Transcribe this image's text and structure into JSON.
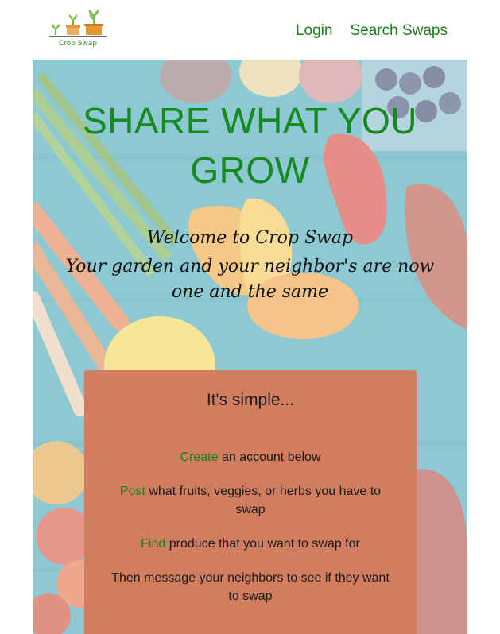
{
  "header": {
    "logo_text": "Crop Swap",
    "nav": [
      {
        "label": "Login"
      },
      {
        "label": "Search Swaps"
      }
    ]
  },
  "hero": {
    "headline": "SHARE WHAT YOU GROW",
    "welcome": "Welcome to Crop Swap",
    "tagline": "Your garden and your neighbor's are now one and the same"
  },
  "steps_card": {
    "title": "It's simple...",
    "steps": [
      {
        "keyword": "Create",
        "text": " an account below"
      },
      {
        "keyword": "Post",
        "text": " what fruits, veggies, or herbs you have to swap"
      },
      {
        "keyword": "Find",
        "text": " produce that you want to swap for"
      },
      {
        "keyword": "",
        "text": "Then message your neighbors to see if they want to swap"
      }
    ]
  },
  "colors": {
    "brand_green": "#168a1f",
    "card_bg": "#d07e5f"
  }
}
